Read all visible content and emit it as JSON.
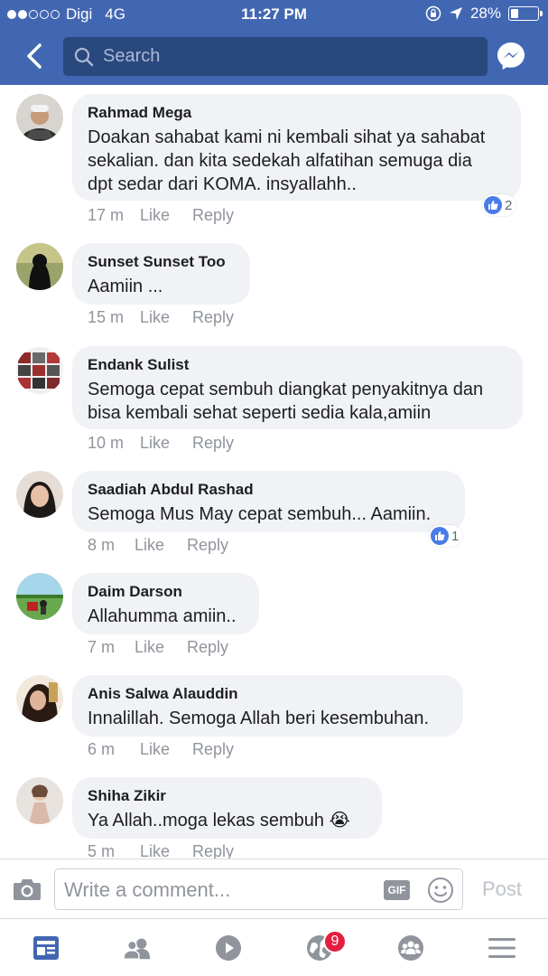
{
  "status_bar": {
    "carrier": "Digi",
    "network": "4G",
    "time": "11:27 PM",
    "battery": "28%",
    "battery_level": 0.28,
    "signal_bars": 2
  },
  "header": {
    "search_placeholder": "Search",
    "icons": [
      "back-arrow-icon",
      "search-icon",
      "messenger-icon"
    ]
  },
  "comments": [
    {
      "author": "Rahmad Mega",
      "text_lines": [
        "Doakan sahabat kami ni kembali sihat ya sahabat",
        "sekalian. dan kita sedekah alfatihan semuga dia",
        "dpt sedar dari KOMA. insyallahh.."
      ],
      "time": "17 m",
      "like": "Like",
      "reply": "Reply",
      "reactions": "2"
    },
    {
      "author": "Sunset Sunset Too",
      "text_lines": [
        "Aamiin ..."
      ],
      "time": "15 m",
      "like": "Like",
      "reply": "Reply"
    },
    {
      "author": "Endank Sulist",
      "text_lines": [
        "Semoga cepat sembuh diangkat penyakitnya dan",
        "bisa kembali sehat seperti sedia kala,amiin"
      ],
      "time": "10 m",
      "like": "Like",
      "reply": "Reply"
    },
    {
      "author": "Saadiah Abdul Rashad",
      "text_lines": [
        "Semoga Mus May cepat sembuh... Aamiin."
      ],
      "time": "8 m",
      "like": "Like",
      "reply": "Reply",
      "reactions": "1"
    },
    {
      "author": "Daim Darson",
      "text_lines": [
        "Allahumma amiin.."
      ],
      "time": "7 m",
      "like": "Like",
      "reply": "Reply"
    },
    {
      "author": "Anis Salwa Alauddin",
      "text_lines": [
        "Innalillah. Semoga Allah beri kesembuhan."
      ],
      "time": "6 m",
      "like": "Like",
      "reply": "Reply"
    },
    {
      "author": "Shiha Zikir",
      "text_lines": [
        "Ya Allah..moga lekas sembuh 😭"
      ],
      "time": "5 m",
      "like": "Like",
      "reply": "Reply"
    }
  ],
  "composer": {
    "placeholder": "Write a comment...",
    "gif_label": "GIF",
    "post_label": "Post"
  },
  "bottom_nav": {
    "items": [
      "news-feed-icon",
      "friends-icon",
      "watch-icon",
      "notifications-globe-icon",
      "groups-icon",
      "menu-icon"
    ],
    "notification_count": "9"
  },
  "colors": {
    "brand": "#4267b2",
    "search_bg": "#29487d",
    "bubble": "#f1f2f6",
    "meta_text": "#90949c",
    "badge": "#e41e3f"
  }
}
